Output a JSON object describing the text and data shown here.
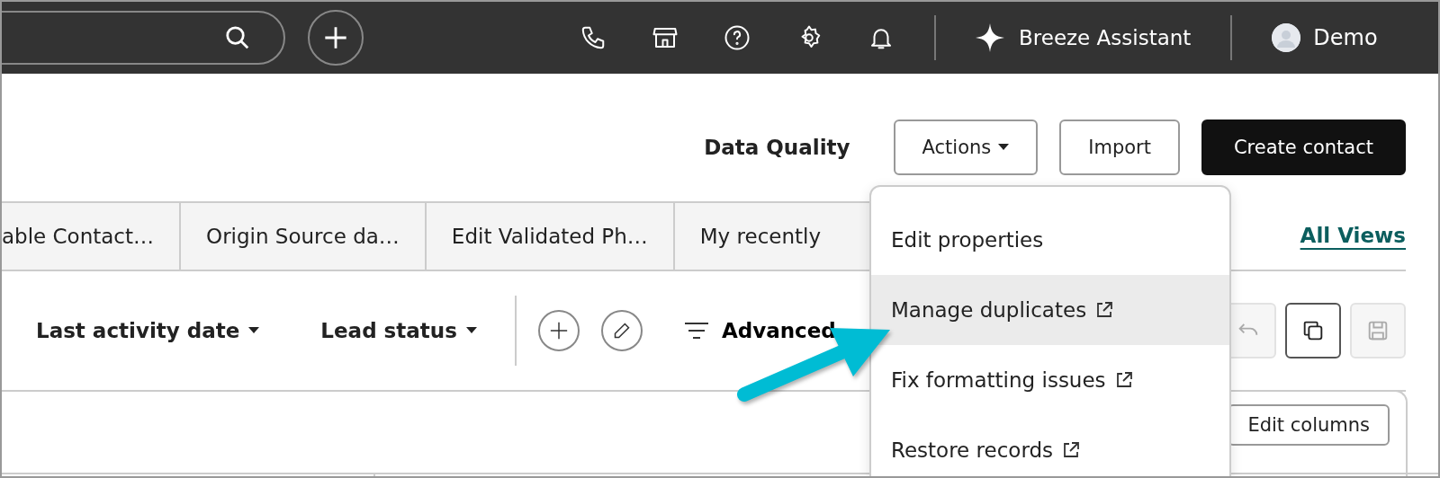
{
  "top_bar": {
    "assistant": "Breeze Assistant",
    "user": "Demo"
  },
  "header": {
    "title": "Data Quality",
    "buttons": [
      {
        "label": "Actions",
        "kind": "dropdown"
      },
      {
        "label": "Import",
        "kind": "outline"
      },
      {
        "label": "Create contact",
        "kind": "primary"
      }
    ]
  },
  "view_tabs": [
    {
      "label": "able Contact…",
      "selected": false
    },
    {
      "label": "Origin Source da…",
      "selected": false
    },
    {
      "label": "Edit Validated Ph…",
      "selected": false
    },
    {
      "label": "My recently",
      "selected": false
    }
  ],
  "all_views": "All Views",
  "filters": [
    {
      "label": "Last activity date"
    },
    {
      "label": "Lead status"
    }
  ],
  "advanced_filters": "Advanced",
  "view_actions": [
    {
      "kind": "undo",
      "disabled": true
    },
    {
      "kind": "copy",
      "disabled": false
    },
    {
      "kind": "save",
      "disabled": true
    }
  ],
  "table": {
    "edit_columns": "Edit columns"
  },
  "actions_menu": {
    "items": [
      {
        "label": "Edit properties",
        "external": false,
        "selected": false
      },
      {
        "label": "Manage duplicates",
        "external": true,
        "selected": true
      },
      {
        "label": "Fix formatting issues",
        "external": true,
        "selected": false
      },
      {
        "label": "Restore records",
        "external": true,
        "selected": false
      }
    ]
  }
}
